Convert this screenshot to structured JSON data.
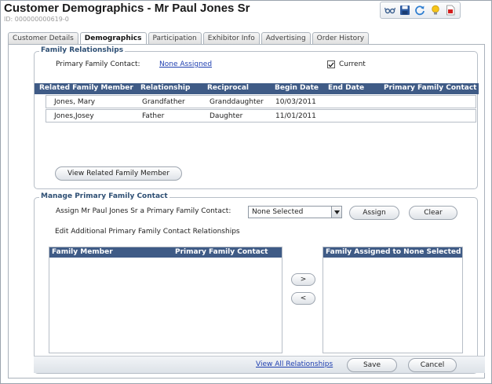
{
  "header": {
    "title": "Customer Demographics - Mr Paul Jones Sr",
    "id_label": "ID: 000000000619-0"
  },
  "toolbar": {
    "icons": [
      "glasses-icon",
      "save-icon",
      "refresh-icon",
      "lightbulb-icon",
      "pdf-icon"
    ]
  },
  "tabs": [
    {
      "label": "Customer Details"
    },
    {
      "label": "Demographics"
    },
    {
      "label": "Participation"
    },
    {
      "label": "Exhibitor Info"
    },
    {
      "label": "Advertising"
    },
    {
      "label": "Order History"
    }
  ],
  "family_relationships": {
    "legend": "Family Relationships",
    "primary_contact_label": "Primary Family Contact:",
    "primary_contact_value": "None Assigned",
    "current_label": "Current",
    "current_checked": true,
    "columns": [
      "Related Family Member",
      "Relationship",
      "Reciprocal",
      "Begin Date",
      "End Date",
      "Primary Family Contact"
    ],
    "rows": [
      {
        "member": "Jones, Mary",
        "relationship": "Grandfather",
        "reciprocal": "Granddaughter",
        "begin": "10/03/2011",
        "end": "",
        "primary": ""
      },
      {
        "member": "Jones,Josey",
        "relationship": "Father",
        "reciprocal": "Daughter",
        "begin": "11/01/2011",
        "end": "",
        "primary": ""
      }
    ],
    "view_button": "View Related Family Member"
  },
  "manage_primary": {
    "legend": "Manage Primary Family Contact",
    "assign_label": "Assign Mr Paul Jones Sr a Primary Family Contact:",
    "select_value": "None Selected",
    "assign_button": "Assign",
    "clear_button": "Clear",
    "edit_label": "Edit Additional Primary Family Contact Relationships",
    "left_columns": [
      "Family Member",
      "Primary Family Contact"
    ],
    "right_column": "Family Assigned to None Selected",
    "move_right": ">",
    "move_left": "<",
    "view_all_link": "View All Relationships",
    "save_button": "Save",
    "cancel_button": "Cancel"
  }
}
